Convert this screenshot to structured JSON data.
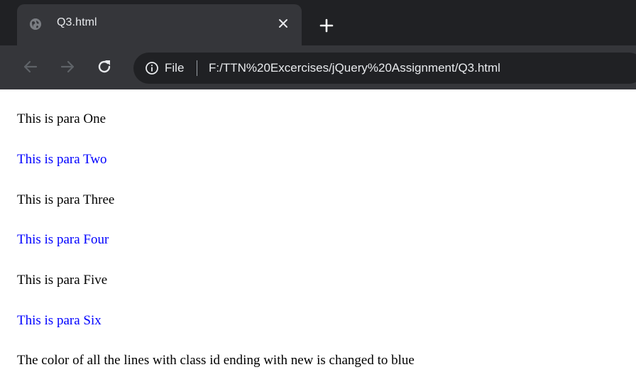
{
  "browser": {
    "tab": {
      "title": "Q3.html",
      "close_icon": "close-icon",
      "favicon_icon": "globe-icon"
    },
    "new_tab_icon": "plus-icon",
    "toolbar": {
      "back_icon": "back-arrow-icon",
      "forward_icon": "forward-arrow-icon",
      "reload_icon": "reload-icon",
      "omnibox": {
        "info_icon": "info-icon",
        "scheme_label": "File",
        "url": "F:/TTN%20Excercises/jQuery%20Assignment/Q3.html"
      }
    }
  },
  "page": {
    "paragraphs": [
      {
        "text": "This is para One",
        "color": "#000000"
      },
      {
        "text": "This is para Two",
        "color": "#0000ff"
      },
      {
        "text": "This is para Three",
        "color": "#000000"
      },
      {
        "text": "This is para Four",
        "color": "#0000ff"
      },
      {
        "text": "This is para Five",
        "color": "#000000"
      },
      {
        "text": "This is para Six",
        "color": "#0000ff"
      },
      {
        "text": "The color of all the lines with class id ending with new is changed to blue",
        "color": "#000000"
      }
    ]
  },
  "colors": {
    "chrome_dark": "#202124",
    "chrome_tab": "#35363a",
    "chrome_text": "#e8eaed",
    "link_blue": "#0000ff"
  }
}
